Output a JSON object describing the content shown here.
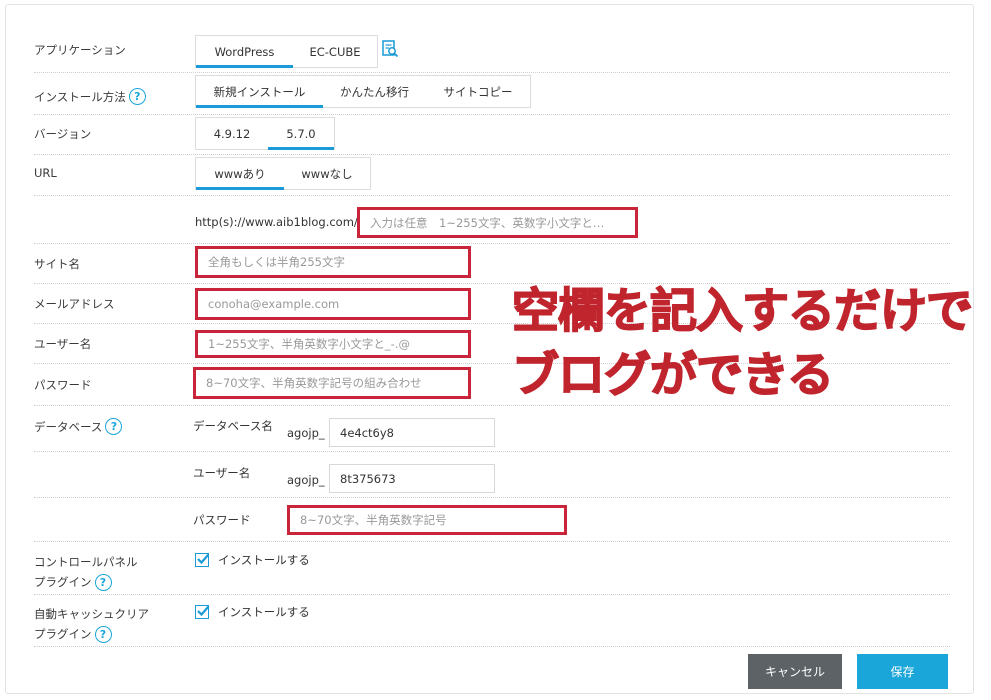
{
  "form": {
    "application": {
      "label": "アプリケーション",
      "options": [
        "WordPress",
        "EC-CUBE"
      ],
      "selected": "WordPress"
    },
    "install_method": {
      "label": "インストール方法",
      "options": [
        "新規インストール",
        "かんたん移行",
        "サイトコピー"
      ],
      "selected": "新規インストール"
    },
    "version": {
      "label": "バージョン",
      "options": [
        "4.9.12",
        "5.7.0"
      ],
      "selected": "5.7.0"
    },
    "url": {
      "label": "URL",
      "options": [
        "wwwあり",
        "wwwなし"
      ],
      "selected": "wwwあり",
      "prefix": "http(s)://www.aib1blog.com/",
      "placeholder": "入力は任意　1~255文字、英数字小文字と…"
    },
    "site_name": {
      "label": "サイト名",
      "placeholder": "全角もしくは半角255文字"
    },
    "email": {
      "label": "メールアドレス",
      "placeholder": "conoha@example.com"
    },
    "username": {
      "label": "ユーザー名",
      "placeholder": "1~255文字、半角英数字小文字と_-.@"
    },
    "password": {
      "label": "パスワード",
      "placeholder": "8~70文字、半角英数字記号の組み合わせ"
    },
    "database": {
      "label": "データベース",
      "db_name_label": "データベース名",
      "db_prefix": "agojp_",
      "db_name_value": "4e4ct6y8",
      "db_user_label": "ユーザー名",
      "db_user_prefix": "agojp_",
      "db_user_value": "8t375673",
      "db_password_label": "パスワード",
      "db_password_placeholder": "8~70文字、半角英数字記号"
    },
    "control_panel_plugin": {
      "label_line1": "コントロールパネル",
      "label_line2": "プラグイン",
      "checkbox_label": "インストールする",
      "checked": true
    },
    "cache_clear_plugin": {
      "label_line1": "自動キャッシュクリア",
      "label_line2": "プラグイン",
      "checkbox_label": "インストールする",
      "checked": true
    }
  },
  "overlay_text": {
    "line1": "空欄を記入するだけで",
    "line2": "ブログができる"
  },
  "buttons": {
    "cancel": "キャンセル",
    "save": "保存"
  },
  "colors": {
    "accent": "#1a9ad6",
    "highlight": "#c8243a",
    "overlay": "#c0242d",
    "cancel_bg": "#5d6266",
    "save_bg": "#1aa6d9"
  }
}
